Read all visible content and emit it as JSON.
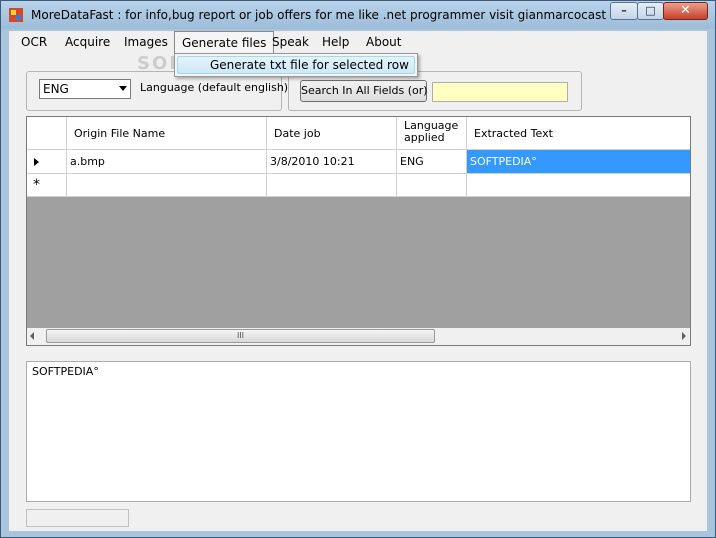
{
  "window": {
    "title": "MoreDataFast : for info,bug report or  job offers for me like .net programmer visit gianmarcocastagna.som..."
  },
  "menu": {
    "items": [
      "OCR",
      "Acquire",
      "Images",
      "Generate files",
      "Speak",
      "Help",
      "About"
    ],
    "open_menu": "Generate files",
    "dropdown_items": [
      "Generate txt file for selected row"
    ]
  },
  "toolbar": {
    "language_value": "ENG",
    "language_label": "Language (default english)",
    "search_button": "Search In All Fields (or)",
    "search_value": ""
  },
  "grid": {
    "columns": [
      "Origin File Name",
      "Date job",
      "Language\napplied",
      "Extracted Text"
    ],
    "rows": [
      {
        "file": "a.bmp",
        "date": "3/8/2010  10:21",
        "language": "ENG",
        "text": "SOFTPEDIA°"
      }
    ],
    "scroll_grip": "III"
  },
  "output": {
    "text": "SOFTPEDIA°"
  },
  "watermark": "SOFTPEDIA",
  "colors": {
    "selection": "#3399ff",
    "search_background": "#ffffc0",
    "title_bar": "#a9c4dd"
  }
}
